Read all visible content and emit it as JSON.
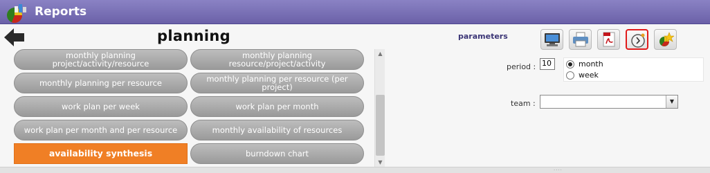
{
  "header": {
    "title": "Reports",
    "icon": "reports-chart-icon",
    "bg_color": "#6b61a8"
  },
  "left": {
    "back_icon": "back-arrow-icon",
    "section_title": "planning",
    "report_buttons": [
      {
        "label": "monthly planning project/activity/resource",
        "active": false
      },
      {
        "label": "monthly planning resource/project/activity",
        "active": false
      },
      {
        "label": "monthly planning per resource",
        "active": false
      },
      {
        "label": "monthly planning per resource (per project)",
        "active": false
      },
      {
        "label": "work plan per week",
        "active": false
      },
      {
        "label": "work plan per month",
        "active": false
      },
      {
        "label": "work plan per month and per resource",
        "active": false
      },
      {
        "label": "monthly availability of resources",
        "active": false
      },
      {
        "label": "availability synthesis",
        "active": true
      },
      {
        "label": "burndown chart",
        "active": false
      }
    ],
    "active_color": "#f07f25"
  },
  "params": {
    "label": "parameters",
    "toolbar": [
      {
        "name": "display-icon",
        "selected": false
      },
      {
        "name": "print-icon",
        "selected": false
      },
      {
        "name": "pdf-icon",
        "selected": false
      },
      {
        "name": "clock-icon",
        "selected": true
      },
      {
        "name": "favorite-icon",
        "selected": false
      }
    ],
    "period": {
      "label": "period :",
      "value": "10",
      "options": [
        {
          "label": "month",
          "checked": true
        },
        {
          "label": "week",
          "checked": false
        }
      ]
    },
    "team": {
      "label": "team :",
      "value": ""
    }
  }
}
